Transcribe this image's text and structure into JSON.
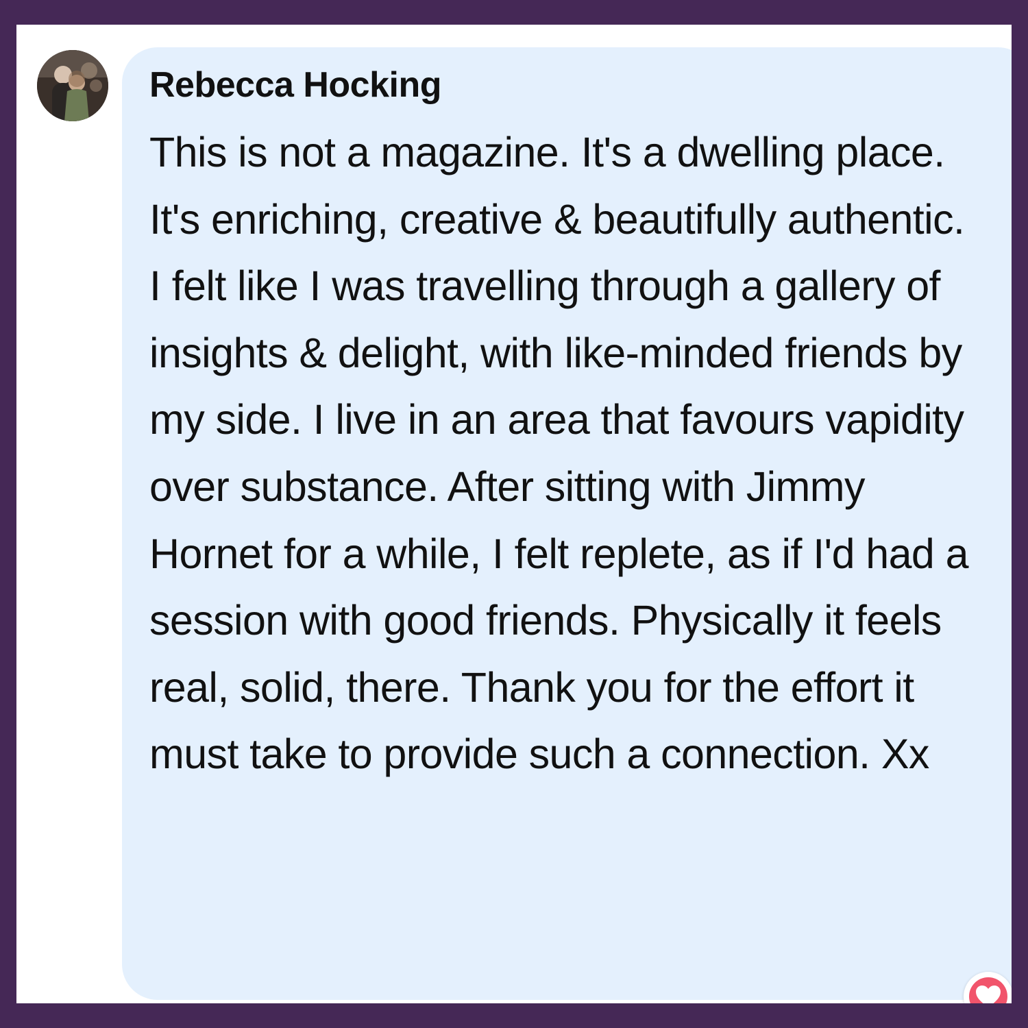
{
  "comment": {
    "author": "Rebecca Hocking",
    "text": "This is not a magazine. It's a dwelling place. It's enriching, creative & beautifully authentic. I felt like I was travelling through a gallery of insights & delight, with like-minded friends by my side. I live in an area that favours vapidity over substance. After sitting with Jimmy Hornet for a while, I felt replete, as if I'd had a session with good friends. Physically it feels real, solid, there. Thank you for the effort it must take to provide such a connection. Xx",
    "avatar_icon": "profile-photo",
    "reaction_icon": "heart-reaction-icon"
  },
  "colors": {
    "border": "#452856",
    "page_background": "#ffffff",
    "bubble_background": "#e4f0fd",
    "text": "#111111",
    "reaction": "#f1546b"
  }
}
